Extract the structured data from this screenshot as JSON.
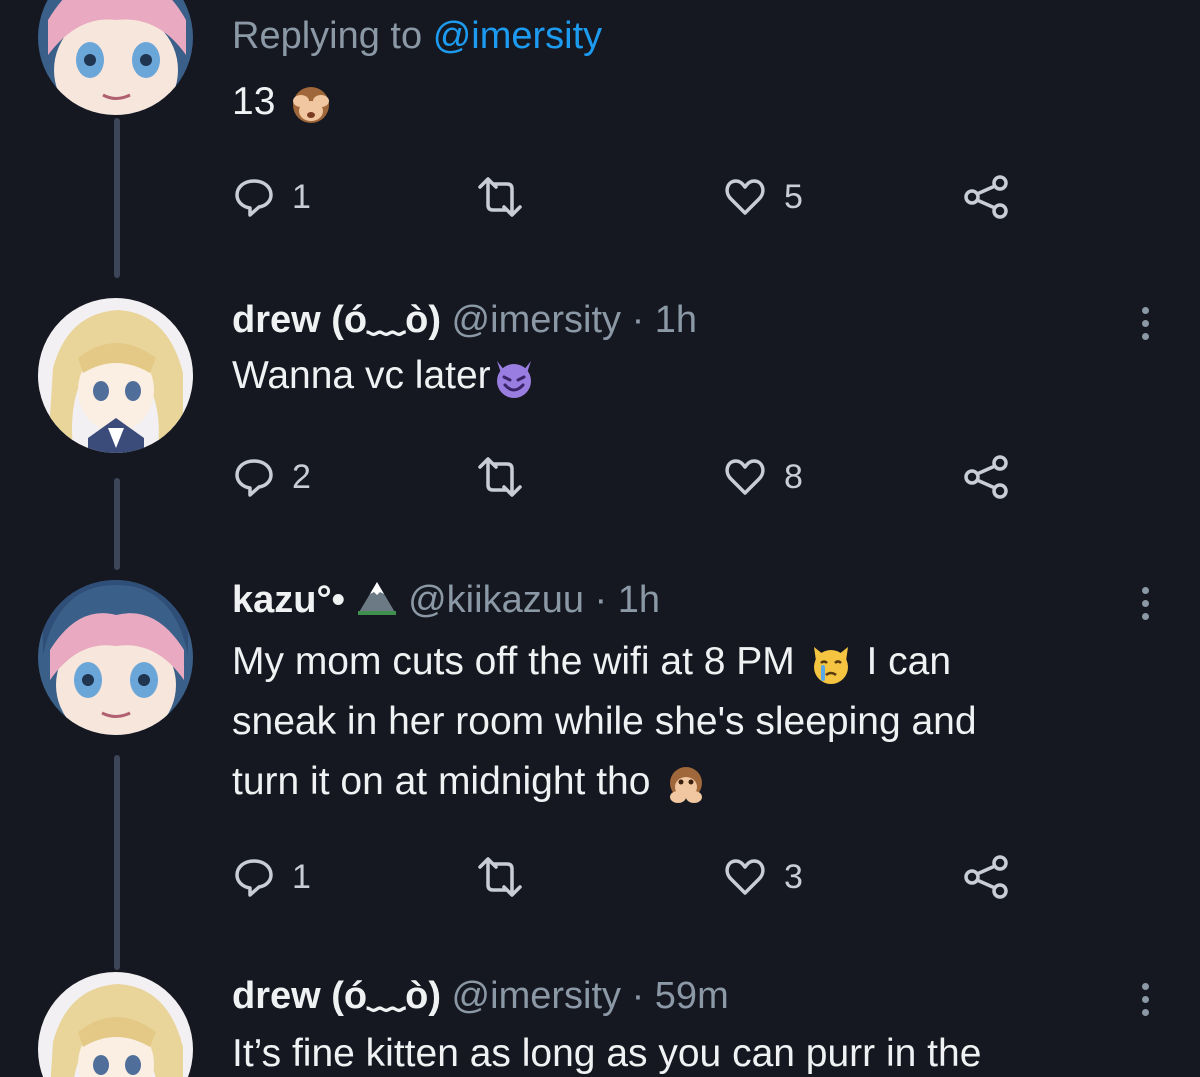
{
  "tweets": [
    {
      "replying_prefix": "Replying to",
      "replying_handle": "@imersity",
      "text": "13",
      "actions": {
        "reply_count": "1",
        "like_count": "5"
      }
    },
    {
      "name": "drew (ó﹏ò)",
      "handle": "@imersity",
      "separator": "·",
      "time": "1h",
      "text": "Wanna vc later",
      "actions": {
        "reply_count": "2",
        "like_count": "8"
      }
    },
    {
      "name": "kazu°•",
      "handle": "@kiikazuu",
      "separator": "·",
      "time": "1h",
      "text_1": "My mom cuts off the wifi at 8 PM",
      "text_2": "I can",
      "text_3": "sneak in her room while she's sleeping and",
      "text_4": "turn it on at midnight tho",
      "actions": {
        "reply_count": "1",
        "like_count": "3"
      }
    },
    {
      "name": "drew (ó﹏ò)",
      "handle": "@imersity",
      "separator": "·",
      "time": "59m",
      "text": "It’s fine kitten as long as you can purr in the"
    }
  ],
  "colors": {
    "background": "#151820",
    "link": "#1d9bf0",
    "muted": "#8b98a5",
    "thread_line": "#3c4658"
  },
  "icons": {
    "reply": "reply-icon",
    "retweet": "retweet-icon",
    "like": "heart-icon",
    "share": "share-icon",
    "more": "more-vertical-icon"
  }
}
